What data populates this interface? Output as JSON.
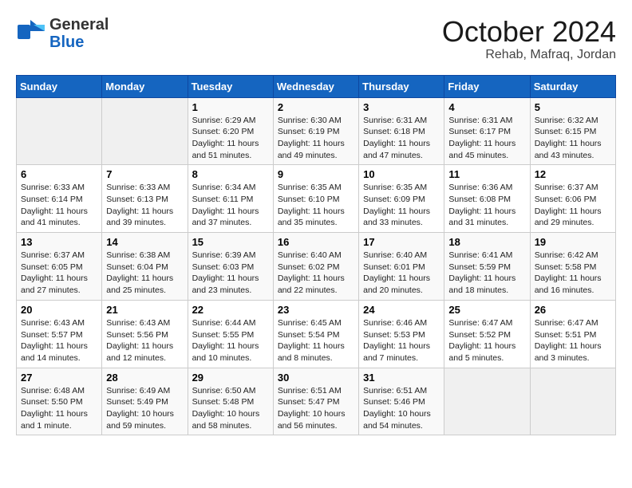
{
  "header": {
    "logo_general": "General",
    "logo_blue": "Blue",
    "month": "October 2024",
    "location": "Rehab, Mafraq, Jordan"
  },
  "days_of_week": [
    "Sunday",
    "Monday",
    "Tuesday",
    "Wednesday",
    "Thursday",
    "Friday",
    "Saturday"
  ],
  "weeks": [
    [
      {
        "day": "",
        "empty": true
      },
      {
        "day": "",
        "empty": true
      },
      {
        "day": "1",
        "sunrise": "6:29 AM",
        "sunset": "6:20 PM",
        "daylight": "11 hours and 51 minutes."
      },
      {
        "day": "2",
        "sunrise": "6:30 AM",
        "sunset": "6:19 PM",
        "daylight": "11 hours and 49 minutes."
      },
      {
        "day": "3",
        "sunrise": "6:31 AM",
        "sunset": "6:18 PM",
        "daylight": "11 hours and 47 minutes."
      },
      {
        "day": "4",
        "sunrise": "6:31 AM",
        "sunset": "6:17 PM",
        "daylight": "11 hours and 45 minutes."
      },
      {
        "day": "5",
        "sunrise": "6:32 AM",
        "sunset": "6:15 PM",
        "daylight": "11 hours and 43 minutes."
      }
    ],
    [
      {
        "day": "6",
        "sunrise": "6:33 AM",
        "sunset": "6:14 PM",
        "daylight": "11 hours and 41 minutes."
      },
      {
        "day": "7",
        "sunrise": "6:33 AM",
        "sunset": "6:13 PM",
        "daylight": "11 hours and 39 minutes."
      },
      {
        "day": "8",
        "sunrise": "6:34 AM",
        "sunset": "6:11 PM",
        "daylight": "11 hours and 37 minutes."
      },
      {
        "day": "9",
        "sunrise": "6:35 AM",
        "sunset": "6:10 PM",
        "daylight": "11 hours and 35 minutes."
      },
      {
        "day": "10",
        "sunrise": "6:35 AM",
        "sunset": "6:09 PM",
        "daylight": "11 hours and 33 minutes."
      },
      {
        "day": "11",
        "sunrise": "6:36 AM",
        "sunset": "6:08 PM",
        "daylight": "11 hours and 31 minutes."
      },
      {
        "day": "12",
        "sunrise": "6:37 AM",
        "sunset": "6:06 PM",
        "daylight": "11 hours and 29 minutes."
      }
    ],
    [
      {
        "day": "13",
        "sunrise": "6:37 AM",
        "sunset": "6:05 PM",
        "daylight": "11 hours and 27 minutes."
      },
      {
        "day": "14",
        "sunrise": "6:38 AM",
        "sunset": "6:04 PM",
        "daylight": "11 hours and 25 minutes."
      },
      {
        "day": "15",
        "sunrise": "6:39 AM",
        "sunset": "6:03 PM",
        "daylight": "11 hours and 23 minutes."
      },
      {
        "day": "16",
        "sunrise": "6:40 AM",
        "sunset": "6:02 PM",
        "daylight": "11 hours and 22 minutes."
      },
      {
        "day": "17",
        "sunrise": "6:40 AM",
        "sunset": "6:01 PM",
        "daylight": "11 hours and 20 minutes."
      },
      {
        "day": "18",
        "sunrise": "6:41 AM",
        "sunset": "5:59 PM",
        "daylight": "11 hours and 18 minutes."
      },
      {
        "day": "19",
        "sunrise": "6:42 AM",
        "sunset": "5:58 PM",
        "daylight": "11 hours and 16 minutes."
      }
    ],
    [
      {
        "day": "20",
        "sunrise": "6:43 AM",
        "sunset": "5:57 PM",
        "daylight": "11 hours and 14 minutes."
      },
      {
        "day": "21",
        "sunrise": "6:43 AM",
        "sunset": "5:56 PM",
        "daylight": "11 hours and 12 minutes."
      },
      {
        "day": "22",
        "sunrise": "6:44 AM",
        "sunset": "5:55 PM",
        "daylight": "11 hours and 10 minutes."
      },
      {
        "day": "23",
        "sunrise": "6:45 AM",
        "sunset": "5:54 PM",
        "daylight": "11 hours and 8 minutes."
      },
      {
        "day": "24",
        "sunrise": "6:46 AM",
        "sunset": "5:53 PM",
        "daylight": "11 hours and 7 minutes."
      },
      {
        "day": "25",
        "sunrise": "6:47 AM",
        "sunset": "5:52 PM",
        "daylight": "11 hours and 5 minutes."
      },
      {
        "day": "26",
        "sunrise": "6:47 AM",
        "sunset": "5:51 PM",
        "daylight": "11 hours and 3 minutes."
      }
    ],
    [
      {
        "day": "27",
        "sunrise": "6:48 AM",
        "sunset": "5:50 PM",
        "daylight": "11 hours and 1 minute."
      },
      {
        "day": "28",
        "sunrise": "6:49 AM",
        "sunset": "5:49 PM",
        "daylight": "10 hours and 59 minutes."
      },
      {
        "day": "29",
        "sunrise": "6:50 AM",
        "sunset": "5:48 PM",
        "daylight": "10 hours and 58 minutes."
      },
      {
        "day": "30",
        "sunrise": "6:51 AM",
        "sunset": "5:47 PM",
        "daylight": "10 hours and 56 minutes."
      },
      {
        "day": "31",
        "sunrise": "6:51 AM",
        "sunset": "5:46 PM",
        "daylight": "10 hours and 54 minutes."
      },
      {
        "day": "",
        "empty": true
      },
      {
        "day": "",
        "empty": true
      }
    ]
  ],
  "labels": {
    "sunrise": "Sunrise:",
    "sunset": "Sunset:",
    "daylight": "Daylight:"
  }
}
